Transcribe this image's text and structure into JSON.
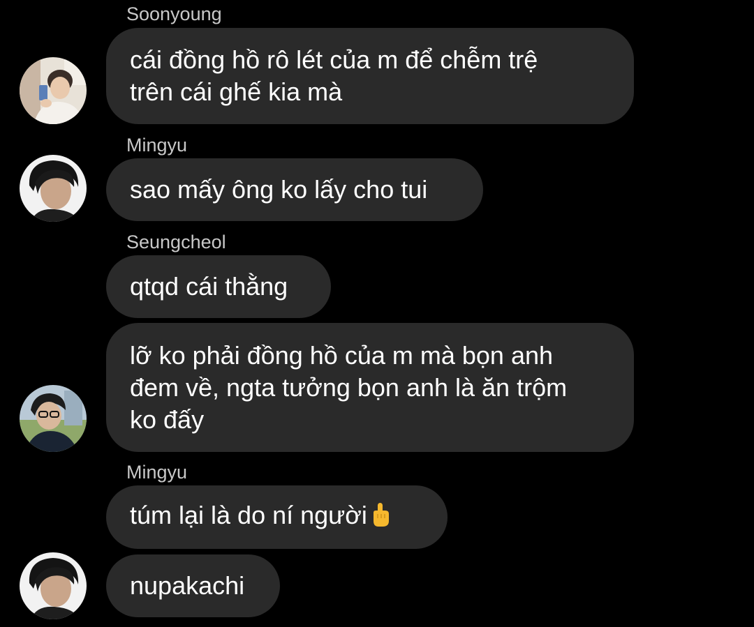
{
  "messages": [
    {
      "sender": "Soonyoung",
      "lines": [
        "cái đồng hồ rô lét của m để chễm trệ",
        "trên cái ghế kia mà"
      ]
    },
    {
      "sender": "Mingyu",
      "lines": [
        "sao mấy ông ko lấy cho tui"
      ]
    },
    {
      "sender": "Seungcheol",
      "lines": [
        "qtqd cái thằng"
      ]
    },
    {
      "sender": "",
      "lines": [
        "lỡ ko phải đồng hồ của m mà bọn anh",
        "đem về, ngta tưởng bọn anh là ăn trộm",
        "ko đấy"
      ]
    },
    {
      "sender": "Mingyu",
      "text": "túm lại là do ní người",
      "emoji": "pointing-up-hand-icon"
    },
    {
      "sender": "",
      "lines": [
        "nupakachi"
      ]
    }
  ],
  "avatars": [
    {
      "name": "Soonyoung",
      "icon": "profile-photo"
    },
    {
      "name": "Mingyu",
      "icon": "profile-photo"
    },
    {
      "name": "Seungcheol",
      "icon": "profile-photo"
    },
    {
      "name": "Mingyu",
      "icon": "profile-photo"
    }
  ],
  "colors": {
    "background": "#000000",
    "bubble": "#2a2a2a",
    "sender_name": "#c8c8c8",
    "message_text": "#ffffff",
    "emoji": "#f5b82e"
  }
}
